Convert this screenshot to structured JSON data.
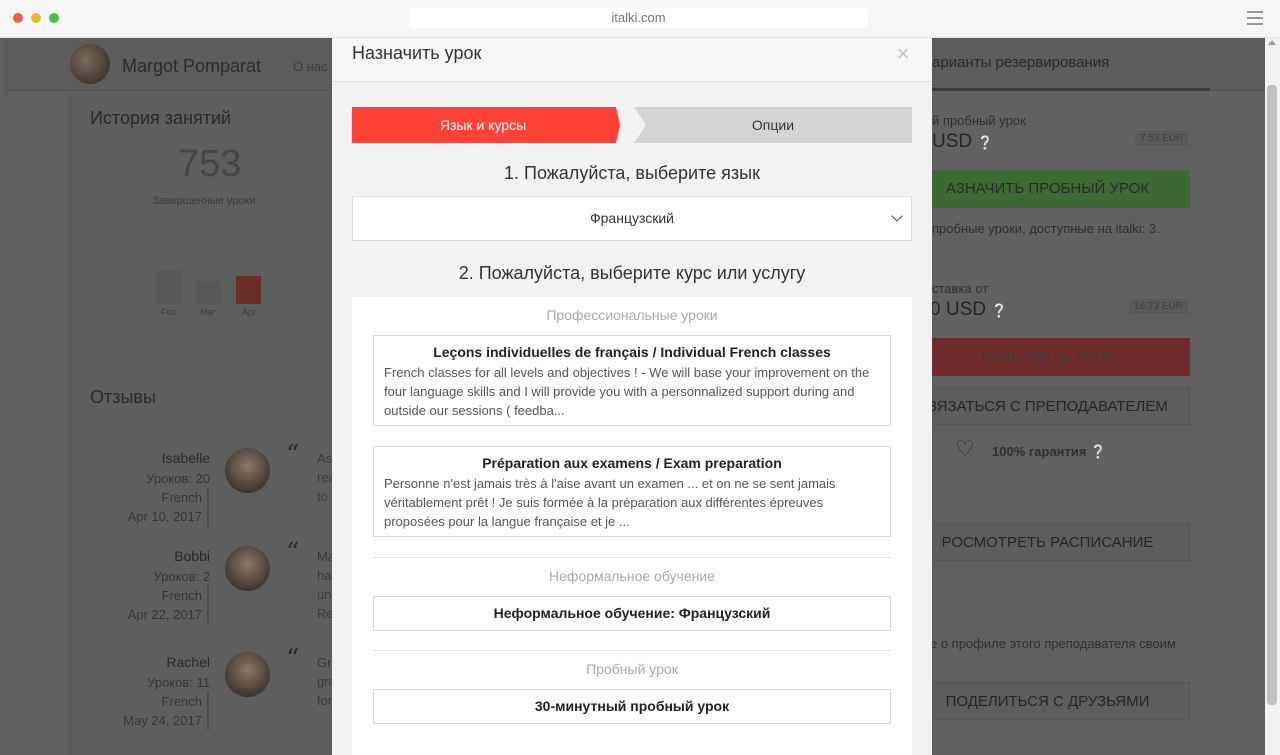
{
  "browser": {
    "url": "italki.com"
  },
  "page": {
    "teacher_name": "Margot Pomparat",
    "about_link": "О нас",
    "booking_tab": "Варианты резервирования",
    "history_title": "История занятий",
    "lessons_count": "753",
    "lessons_label": "Завершенные уроки",
    "months": [
      "Feb",
      "Mar",
      "Apr"
    ],
    "reviews_title": "Отзывы",
    "reviews": [
      {
        "name": "Isabelle",
        "lessons": "Уроков: 20",
        "language": "French",
        "date": "Apr 10, 2017",
        "excerpt": "As\nrea\nto"
      },
      {
        "name": "Bobbi",
        "lessons": "Уроков: 2",
        "language": "French",
        "date": "Apr 22, 2017",
        "excerpt": "Ma\nha\nun\nRe"
      },
      {
        "name": "Rachel",
        "lessons": "Уроков: 11",
        "language": "French",
        "date": "May 24, 2017",
        "excerpt": "Gre\ngra\nfor"
      }
    ],
    "trial_label": "й пробный урок",
    "trial_price": "USD",
    "trial_eur": "7.53 EUR",
    "trial_button": "АЗНАЧИТЬ ПРОБНЫЙ УРОК",
    "trial_note": "пробные уроки, доступные на italki: 3.",
    "rate_label": "ставка от",
    "rate_price": "0  USD",
    "rate_eur": "16.73 EUR",
    "book_button": "НАЗНАЧИТЬ УРОК",
    "contact_button": "ВЯЗАТЬСЯ С ПРЕПОДАВАТЕЛЕМ",
    "guarantee": "100% гарантия",
    "schedule_button": "РОСМОТРЕТЬ РАСПИСАНИЕ",
    "share_note": "е о профиле этого преподавателя своим",
    "share_button": "ПОДЕЛИТЬСЯ С ДРУЗЬЯМИ"
  },
  "modal": {
    "title": "Назначить урок",
    "close": "×",
    "steps": [
      "Язык и курсы",
      "Опции"
    ],
    "q1": "1. Пожалуйста, выберите язык",
    "language_value": "Французский",
    "q2": "2. Пожалуйста, выберите курс или услугу",
    "categories": {
      "professional": "Профессиональные уроки",
      "informal": "Неформальное обучение",
      "trial": "Пробный урок"
    },
    "courses": [
      {
        "title": "Leçons individuelles de français / Individual French classes",
        "description": "French classes for all levels and objectives ! - We will base your improvement on the four language skills and I will provide you with a personnalized support during and outside our sessions ( feedba..."
      },
      {
        "title": "Préparation aux examens / Exam preparation",
        "description": "Personne n'est jamais très à l'aise avant un examen ... et on ne se sent jamais véritablement prêt ! Je suis formée à la préparation aux différentes épreuves proposées pour la langue française et je ..."
      }
    ],
    "informal_option": "Неформальное обучение: Французский",
    "trial_option": "30-минутный пробный урок"
  }
}
